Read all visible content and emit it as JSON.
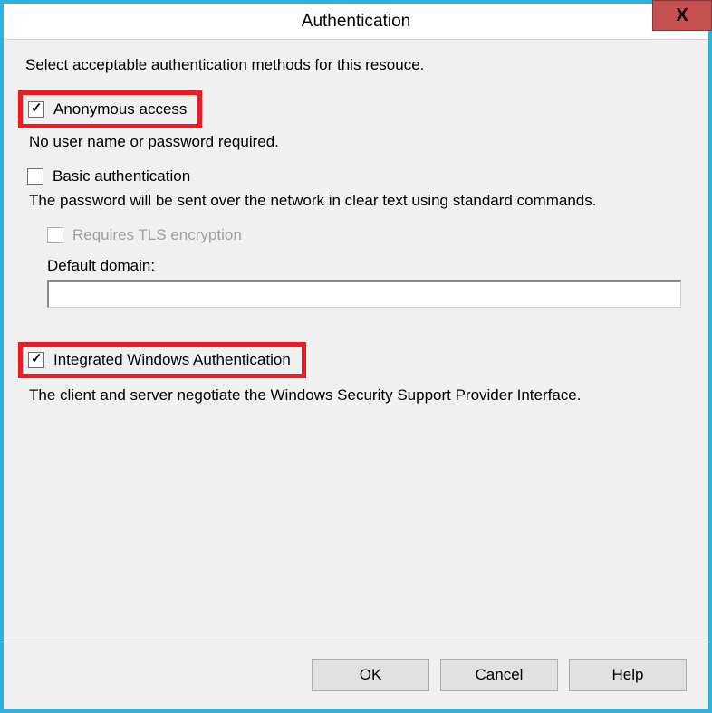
{
  "window": {
    "title": "Authentication",
    "close_label": "X"
  },
  "instruction": "Select acceptable authentication methods for this resouce.",
  "anonymous": {
    "label": "Anonymous access",
    "checked": true,
    "description": "No user name or password required."
  },
  "basic": {
    "label": "Basic authentication",
    "checked": false,
    "description": "The password will be sent over the network in clear text using standard commands.",
    "tls": {
      "label": "Requires TLS encryption",
      "checked": false,
      "enabled": false
    },
    "domain_label": "Default domain:",
    "domain_value": ""
  },
  "iwa": {
    "label": "Integrated Windows Authentication",
    "checked": true,
    "description": "The client and server negotiate the Windows Security Support Provider Interface."
  },
  "buttons": {
    "ok": "OK",
    "cancel": "Cancel",
    "help": "Help"
  },
  "colors": {
    "window_border": "#2db3db",
    "highlight": "#ed1c24",
    "close_bg": "#c75050"
  }
}
